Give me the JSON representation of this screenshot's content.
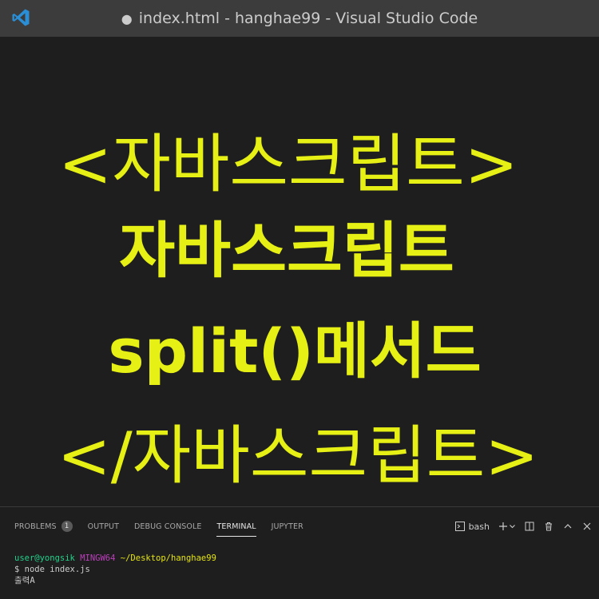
{
  "window": {
    "title": "index.html - hanghae99 - Visual Studio Code",
    "dirty_indicator": "●",
    "app_icon": "vscode-icon"
  },
  "editor": {
    "lines": [
      "<자바스크립트>",
      "자바스크립트",
      "split()메서드",
      "</자바스크립트>"
    ],
    "text_color": "#e6f014",
    "background": "#1e1e1e"
  },
  "panel": {
    "tabs": [
      {
        "label": "PROBLEMS",
        "badge": "1"
      },
      {
        "label": "OUTPUT"
      },
      {
        "label": "DEBUG CONSOLE"
      },
      {
        "label": "TERMINAL",
        "active": true
      },
      {
        "label": "JUPYTER"
      }
    ],
    "shell": "bash",
    "toolbar_icons": [
      "terminal-icon",
      "plus-icon",
      "chevron-down-icon",
      "split-icon",
      "trash-icon",
      "chevron-up-icon",
      "close-icon"
    ]
  },
  "terminal": {
    "prompt_user": "user@yongsik",
    "prompt_host": "MINGW64",
    "prompt_path": "~/Desktop/hanghae99",
    "command": "$ node index.js",
    "output": "출력A"
  }
}
